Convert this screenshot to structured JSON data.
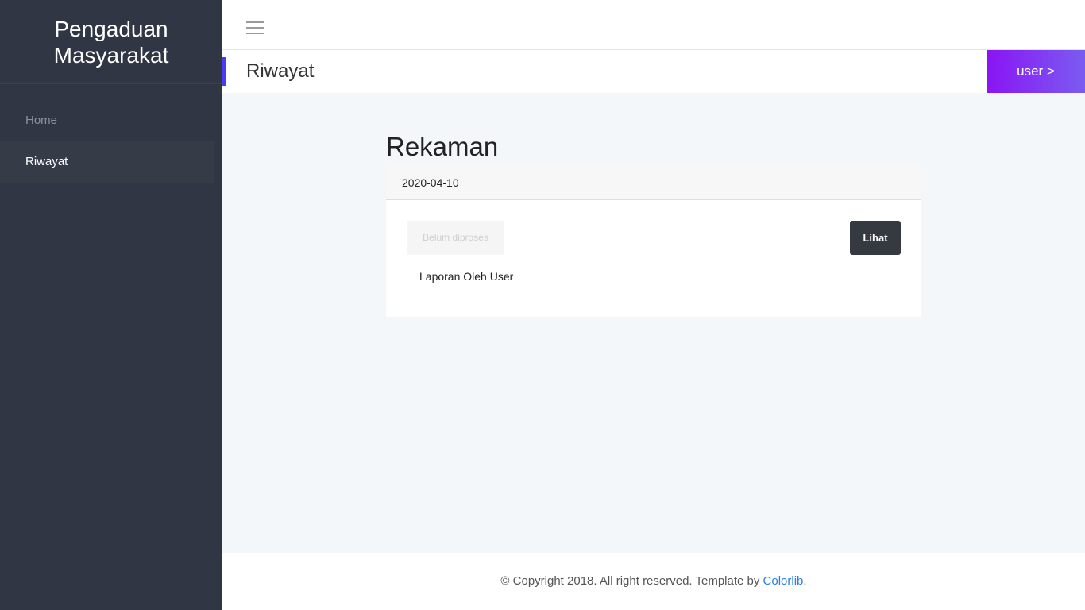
{
  "sidebar": {
    "brand": "Pengaduan Masyarakat",
    "items": [
      {
        "label": "Home",
        "active": false
      },
      {
        "label": "Riwayat",
        "active": true
      }
    ]
  },
  "topbar": {
    "menu_icon": "hamburger-menu-icon"
  },
  "header": {
    "title": "Riwayat",
    "user_button": "user >",
    "accent_color": "#4a3cf2",
    "user_button_gradient": [
      "#8a14f5",
      "#7a5cf0"
    ]
  },
  "main": {
    "section_title": "Rekaman",
    "card": {
      "date": "2020-04-10",
      "status_badge": "Belum diproses",
      "view_button": "Lihat",
      "report_by": "Laporan Oleh User"
    }
  },
  "footer": {
    "text_before": "© Copyright 2018. All right reserved. Template by ",
    "link_text": "Colorlib",
    "text_after": "."
  }
}
